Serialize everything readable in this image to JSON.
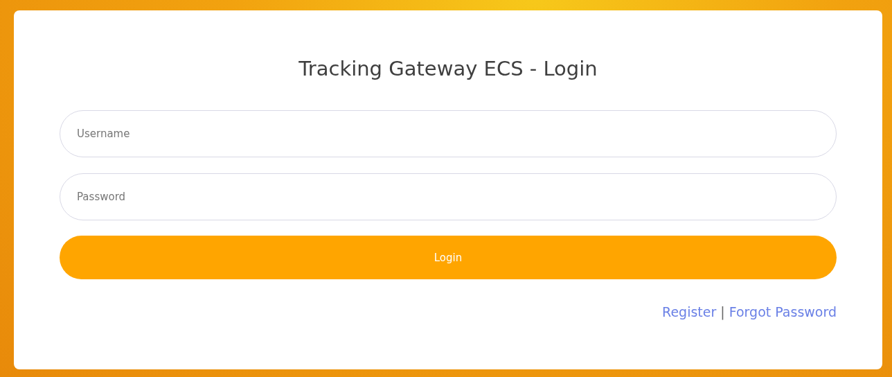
{
  "title": "Tracking Gateway ECS - Login",
  "fields": [
    {
      "placeholder": "Username"
    },
    {
      "placeholder": "Password"
    }
  ],
  "button": {
    "label": "Login"
  },
  "links": [
    {
      "label": "Register"
    },
    {
      "label": "Forgot Password"
    }
  ],
  "separator": "|"
}
